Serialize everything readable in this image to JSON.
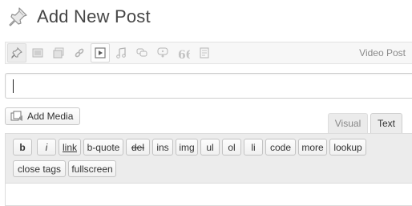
{
  "page": {
    "title": "Add New Post"
  },
  "post_formats": {
    "current_label": "Video Post",
    "icons": [
      "standard-icon",
      "image-icon",
      "gallery-icon",
      "link-icon",
      "video-icon",
      "audio-icon",
      "chat-icon",
      "status-icon",
      "quote-icon",
      "aside-icon"
    ]
  },
  "title_input": {
    "value": ""
  },
  "media": {
    "add_label": "Add Media"
  },
  "tabs": {
    "visual": "Visual",
    "text": "Text"
  },
  "quicktags": [
    "b",
    "i",
    "link",
    "b-quote",
    "del",
    "ins",
    "img",
    "ul",
    "ol",
    "li",
    "code",
    "more",
    "lookup",
    "close tags",
    "fullscreen"
  ],
  "colors": {
    "accent": "#21759b",
    "toolbar_bg": "#ececec",
    "border": "#dcdcdc"
  }
}
